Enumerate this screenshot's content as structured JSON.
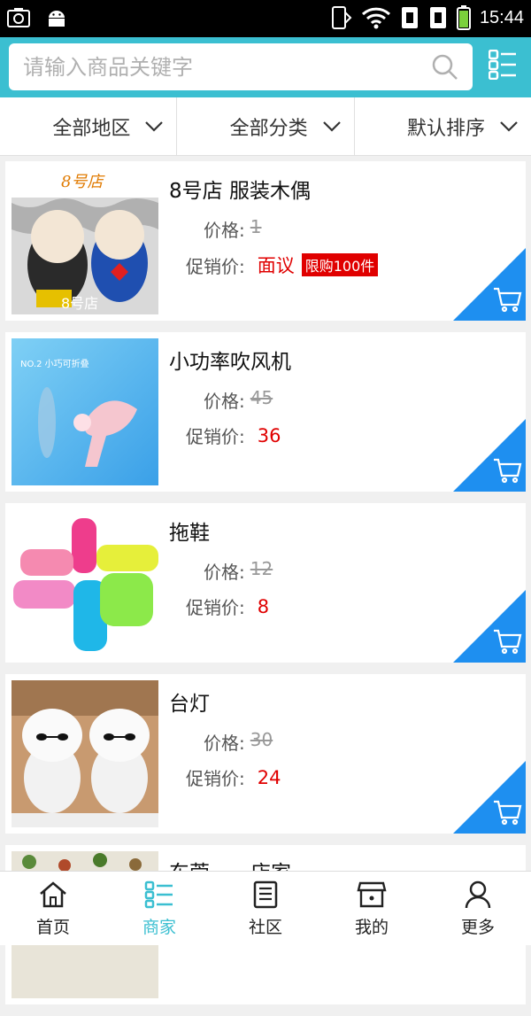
{
  "status_bar": {
    "time": "15:44"
  },
  "search": {
    "placeholder": "请输入商品关键字"
  },
  "filters": [
    {
      "label": "全部地区"
    },
    {
      "label": "全部分类"
    },
    {
      "label": "默认排序"
    }
  ],
  "labels": {
    "price": "价格:",
    "promo": "促销价:"
  },
  "products": [
    {
      "title": "8号店 服装木偶",
      "price": "1",
      "promo": "面议",
      "badge": "限购100件",
      "thumb_text": "8号店"
    },
    {
      "title": "小功率吹风机",
      "price": "45",
      "promo": "36",
      "thumb_text": "NO.2 小巧可折叠"
    },
    {
      "title": "拖鞋",
      "price": "12",
      "promo": "8"
    },
    {
      "title": "台灯",
      "price": "30",
      "promo": "24"
    },
    {
      "title": "东莞——店家"
    }
  ],
  "tabs": [
    {
      "label": "首页",
      "icon": "home-icon"
    },
    {
      "label": "商家",
      "icon": "list-icon",
      "active": true
    },
    {
      "label": "社区",
      "icon": "document-icon"
    },
    {
      "label": "我的",
      "icon": "store-icon"
    },
    {
      "label": "更多",
      "icon": "user-icon"
    }
  ],
  "colors": {
    "accent": "#3bbfd1",
    "price_red": "#e00000",
    "cart_blue": "#1e8ff0"
  }
}
